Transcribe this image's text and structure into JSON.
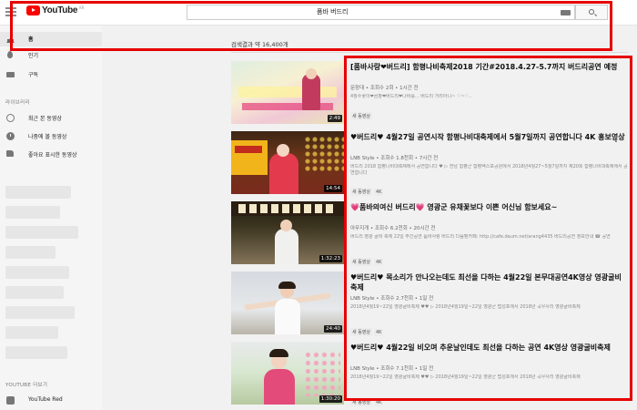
{
  "app": {
    "logo_text": "YouTube",
    "logo_region": "KR"
  },
  "search": {
    "query": "품바 버드리"
  },
  "sidebar": {
    "items": [
      {
        "label": "홈",
        "icon": "home-icon",
        "active": true
      },
      {
        "label": "인기",
        "icon": "fire-icon"
      },
      {
        "label": "구독",
        "icon": "subscriptions-icon"
      }
    ],
    "library_heading": "라이브러리",
    "library_items": [
      {
        "label": "최근 본 동영상",
        "icon": "history-icon"
      },
      {
        "label": "나중에 볼 동영상",
        "icon": "watch-later-icon"
      },
      {
        "label": "좋아요 표시한 동영상",
        "icon": "thumbs-up-icon"
      }
    ],
    "more_heading": "YOUTUBE 더보기",
    "more_items": [
      {
        "label": "YouTube Red",
        "icon": "youtube-red-icon"
      }
    ]
  },
  "results": {
    "count_text": "검색결과 약 16,400개",
    "items": [
      {
        "title": "[품바사랑❤버드리] 함평나비축제2018 기간#2018.4.27-5.7까지 버드리공연 예정",
        "meta": "문장대 • 조회수 2회 • 1시간 전",
        "desc": "4월수꽃이❤곰팡❤버드리❤나비를... 버드리 거리아니~ ♡~♡..",
        "badges": [
          "새 동영상"
        ],
        "duration": "2:49"
      },
      {
        "title": "♥버드리♥ 4월27일 공연시작 함평나비대축제에서 5월7일까지 공연합니다 4K 홍보영상",
        "meta": "LNB Style • 조회수 1.8천회 • 7시간 전",
        "desc": "버드리 2018 함평나비대축제에서 공연합니다 ♥ ▷ 전남 함평군 함평엑스포공원에서 2018년4월27~5월7일까지 제20회 함평나비대축제에서 공연합니다",
        "badges": [
          "새 동영상",
          "4K"
        ],
        "duration": "14:54"
      },
      {
        "title": "💗품바의여신 버드리💗 영광군 유채꽃보다 이쁜 어신님 함보세요~",
        "meta": "아무지개 • 조회수 6.2천회 • 20시간 전",
        "desc": "버드리 영광 굴비 축제 22일 주간공연 품바사랑 버드리 다음팬카페: http://cafe.daum.net/arang4435 버드리공연 정보안내 ☎ 공연",
        "badges": [
          "새 동영상",
          "4K"
        ],
        "duration": "1:32:23"
      },
      {
        "title": "♥버드리♥ 목소리가 안나오는데도 최선을 다하는 4월22일 본무대공연4K영상 영광굴비축제",
        "meta": "LNB Style • 조회수 2.7천회 • 1일 전",
        "desc": "2018년4월19~22일 영광굴비축제 ♥♥ ▷ 2018년4월19일~22일 영광군 법성포에서 2018년 곡우사리 영광굴비축제",
        "badges": [
          "새 동영상",
          "4K"
        ],
        "duration": "24:40"
      },
      {
        "title": "♥버드리♥ 4월22일 비오며 추운날인데도 최선을 다하는 공연 4K영상 영광굴비축제",
        "meta": "LNB Style • 조회수 7.1천회 • 1일 전",
        "desc": "2018년4월19~22일 영광굴비축제 ♥♥ ▷ 2018년4월19일~22일 영광군 법성포에서 2018년 곡우사리 영광굴비축제",
        "badges": [
          "새 동영상",
          "4K"
        ],
        "duration": "1:30:20"
      }
    ]
  },
  "colors": {
    "highlight": "#e60000",
    "brand": "#ff0000"
  }
}
